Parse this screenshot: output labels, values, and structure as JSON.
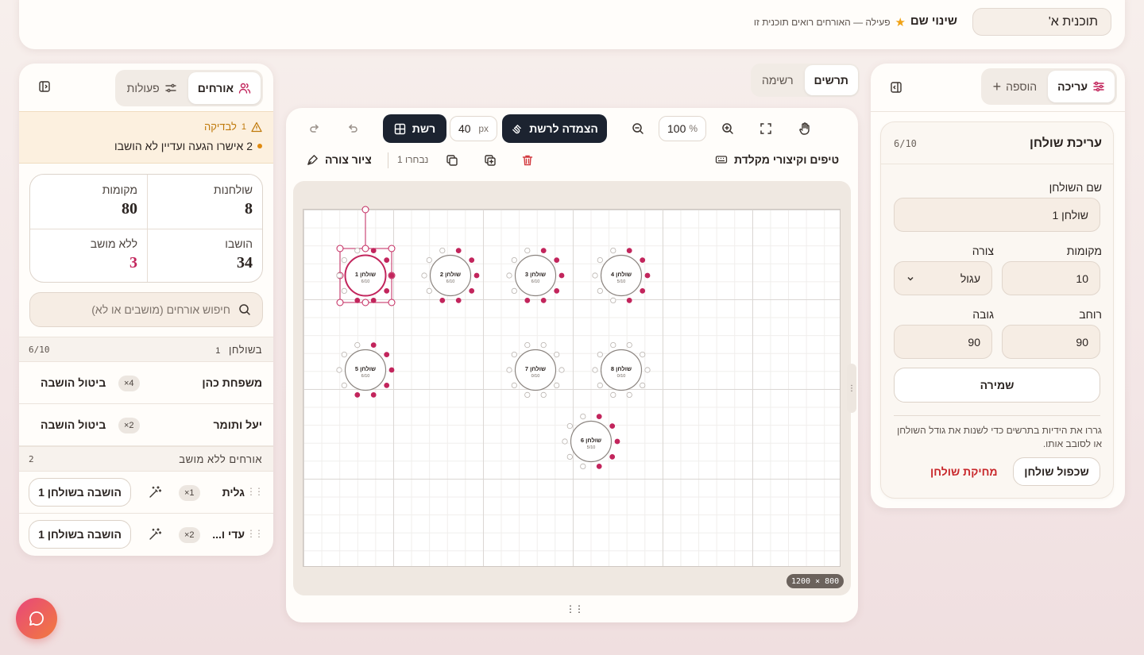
{
  "topbar": {
    "plan_name": "תוכנית א'",
    "rename_label": "שינוי שם",
    "active_status": "פעילה — האורחים רואים תוכנית זו"
  },
  "right_panel": {
    "tabs": {
      "add": "הוספה",
      "edit": "עריכה"
    },
    "editor": {
      "title": "עריכת שולחן",
      "count": "6/10",
      "name_label": "שם השולחן",
      "name_value": "שולחן 1",
      "seats_label": "מקומות",
      "seats_value": "10",
      "shape_label": "צורה",
      "shape_value": "עגול",
      "width_label": "רוחב",
      "width_value": "90",
      "height_label": "גובה",
      "height_value": "90",
      "save_label": "שמירה",
      "hint": "גררו את הידיות בתרשים כדי לשנות את גודל השולחן או לסובב אותו.",
      "duplicate_label": "שכפול שולחן",
      "delete_label": "מחיקת שולחן"
    }
  },
  "view_tabs": {
    "diagram": "תרשים",
    "list": "רשימה"
  },
  "toolbar": {
    "grid_label": "רשת",
    "grid_size": "40",
    "grid_unit": "px",
    "snap_label": "הצמדה לרשת",
    "zoom_value": "100",
    "zoom_unit": "%",
    "tips_label": "טיפים וקיצורי מקלדת",
    "selected_label": "נבחרו 1",
    "draw_label": "ציור צורה"
  },
  "canvas": {
    "dimensions": "1200 × 800",
    "tables": [
      {
        "name": "שולחן 1",
        "occupancy": "6/10",
        "seats": 10,
        "filled": 6,
        "selected": true
      },
      {
        "name": "שולחן 2",
        "occupancy": "6/10",
        "seats": 10,
        "filled": 6
      },
      {
        "name": "שולחן 3",
        "occupancy": "6/10",
        "seats": 10,
        "filled": 6
      },
      {
        "name": "שולחן 4",
        "occupancy": "5/10",
        "seats": 10,
        "filled": 5
      },
      {
        "name": "שולחן 5",
        "occupancy": "6/10",
        "seats": 10,
        "filled": 6
      },
      {
        "name": "שולחן 7",
        "occupancy": "0/10",
        "seats": 10,
        "filled": 0
      },
      {
        "name": "שולחן 8",
        "occupancy": "0/10",
        "seats": 10,
        "filled": 0
      },
      {
        "name": "שולחן 6",
        "occupancy": "5/10",
        "seats": 10,
        "filled": 5
      }
    ]
  },
  "left_panel": {
    "tabs": {
      "guests": "אורחים",
      "actions": "פעולות"
    },
    "warning": {
      "title": "לבדיקה",
      "count": "1",
      "item": "2 אישרו הגעה ועדיין לא הושבו"
    },
    "stats": {
      "tables_label": "שולחנות",
      "tables_value": "8",
      "seats_label": "מקומות",
      "seats_value": "80",
      "seated_label": "הושבו",
      "seated_value": "34",
      "unseated_label": "ללא מושב",
      "unseated_value": "3"
    },
    "search_placeholder": "חיפוש אורחים (מושבים או לא)",
    "table_section": {
      "title": "בשולחן",
      "index": "1",
      "count": "6/10"
    },
    "table_guests": [
      {
        "name": "משפחת כהן",
        "count": "×4",
        "action": "ביטול הושבה"
      },
      {
        "name": "יעל ותומר",
        "count": "×2",
        "action": "ביטול הושבה"
      }
    ],
    "unseated_section": {
      "title": "אורחים ללא מושב",
      "count": "2"
    },
    "unseated_guests": [
      {
        "name": "גלית",
        "count": "×1",
        "action": "הושבה בשולחן 1"
      },
      {
        "name": "עדי ו...",
        "count": "×2",
        "action": "הושבה בשולחן 1"
      }
    ]
  },
  "colors": {
    "accent": "#c2255c",
    "dark": "#1c2330",
    "warn": "#e08a10",
    "danger": "#c8272b"
  }
}
